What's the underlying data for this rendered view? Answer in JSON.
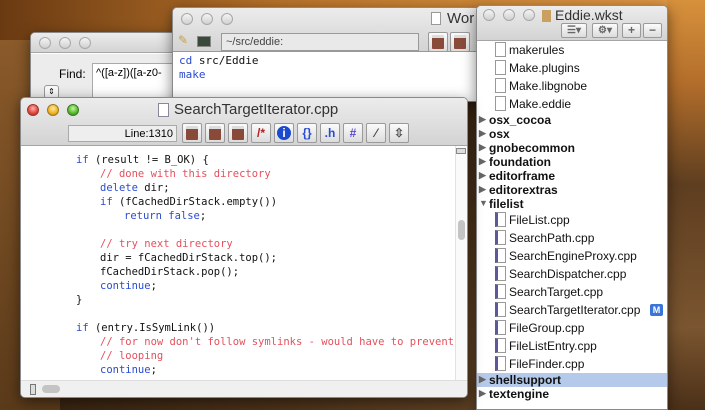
{
  "find_window": {
    "find_label": "Find:",
    "find_value": "^([a-z])([a-z0-"
  },
  "worksheet_window": {
    "title": "Wor",
    "path": "~/src/eddie:",
    "lines": [
      [
        {
          "t": "cd",
          "k": "kw"
        },
        {
          "t": " src/Eddie",
          "k": ""
        }
      ],
      [
        {
          "t": "make",
          "k": "kw"
        }
      ]
    ]
  },
  "workspace_window": {
    "title": "Eddie.wkst",
    "items": [
      {
        "label": "makerules",
        "type": "file"
      },
      {
        "label": "Make.plugins",
        "type": "file"
      },
      {
        "label": "Make.libgnobe",
        "type": "file"
      },
      {
        "label": "Make.eddie",
        "type": "file"
      },
      {
        "label": "osx_cocoa",
        "type": "folder"
      },
      {
        "label": "osx",
        "type": "folder"
      },
      {
        "label": "gnobecommon",
        "type": "folder"
      },
      {
        "label": "foundation",
        "type": "folder"
      },
      {
        "label": "editorframe",
        "type": "folder"
      },
      {
        "label": "editorextras",
        "type": "folder"
      },
      {
        "label": "filelist",
        "type": "folder",
        "expanded": true
      },
      {
        "label": "FileList.cpp",
        "type": "cpp"
      },
      {
        "label": "SearchPath.cpp",
        "type": "cpp"
      },
      {
        "label": "SearchEngineProxy.cpp",
        "type": "cpp"
      },
      {
        "label": "SearchDispatcher.cpp",
        "type": "cpp"
      },
      {
        "label": "SearchTarget.cpp",
        "type": "cpp"
      },
      {
        "label": "SearchTargetIterator.cpp",
        "type": "cpp",
        "badge": "M"
      },
      {
        "label": "FileGroup.cpp",
        "type": "cpp"
      },
      {
        "label": "FileListEntry.cpp",
        "type": "cpp"
      },
      {
        "label": "FileFinder.cpp",
        "type": "cpp"
      },
      {
        "label": "shellsupport",
        "type": "folder",
        "selected": true
      },
      {
        "label": "textengine",
        "type": "folder"
      }
    ]
  },
  "code_window": {
    "title": "SearchTargetIterator.cpp",
    "line_indicator": "Line:1310",
    "toolbar": [
      {
        "name": "clipboard-1",
        "glyph": ""
      },
      {
        "name": "clipboard-2",
        "glyph": ""
      },
      {
        "name": "clipboard-3",
        "glyph": ""
      },
      {
        "name": "comment",
        "glyph": "/*"
      },
      {
        "name": "info",
        "glyph": "i"
      },
      {
        "name": "braces",
        "glyph": "{}"
      },
      {
        "name": "header",
        "glyph": ".h"
      },
      {
        "name": "hash",
        "glyph": "#"
      },
      {
        "name": "ruler",
        "glyph": "⁄"
      },
      {
        "name": "updown",
        "glyph": "⇳"
      }
    ],
    "lines": [
      {
        "i": 0,
        "s": [
          {
            "t": "if",
            "k": "kw"
          },
          {
            "t": " (result != B_OK) {",
            "k": ""
          }
        ]
      },
      {
        "i": 1,
        "s": [
          {
            "t": "// done with this directory",
            "k": "cm"
          }
        ]
      },
      {
        "i": 1,
        "s": [
          {
            "t": "delete",
            "k": "kw"
          },
          {
            "t": " dir;",
            "k": ""
          }
        ]
      },
      {
        "i": 1,
        "s": [
          {
            "t": "if",
            "k": "kw"
          },
          {
            "t": " (fCachedDirStack.empty())",
            "k": ""
          }
        ]
      },
      {
        "i": 2,
        "s": [
          {
            "t": "return false",
            "k": "kw"
          },
          {
            "t": ";",
            "k": ""
          }
        ]
      },
      {
        "i": 0,
        "s": []
      },
      {
        "i": 1,
        "s": [
          {
            "t": "// try next directory",
            "k": "cm"
          }
        ]
      },
      {
        "i": 1,
        "s": [
          {
            "t": "dir = fCachedDirStack.top();",
            "k": ""
          }
        ]
      },
      {
        "i": 1,
        "s": [
          {
            "t": "fCachedDirStack.pop();",
            "k": ""
          }
        ]
      },
      {
        "i": 1,
        "s": [
          {
            "t": "continue",
            "k": "kw"
          },
          {
            "t": ";",
            "k": ""
          }
        ]
      },
      {
        "i": 0,
        "s": [
          {
            "t": "}",
            "k": ""
          }
        ]
      },
      {
        "i": 0,
        "s": []
      },
      {
        "i": 0,
        "s": [
          {
            "t": "if",
            "k": "kw"
          },
          {
            "t": " (entry.IsSymLink())",
            "k": ""
          }
        ]
      },
      {
        "i": 1,
        "s": [
          {
            "t": "// for now don't follow symlinks - would have to prevent",
            "k": "cm"
          }
        ]
      },
      {
        "i": 1,
        "s": [
          {
            "t": "// looping",
            "k": "cm"
          }
        ]
      },
      {
        "i": 1,
        "s": [
          {
            "t": "continue",
            "k": "kw"
          },
          {
            "t": ";",
            "k": ""
          }
        ]
      }
    ]
  },
  "colors": {
    "keyword": "#2a4bd0",
    "comment": "#e4505c",
    "selection": "#b5c9ea",
    "badge": "#3a74d8"
  }
}
